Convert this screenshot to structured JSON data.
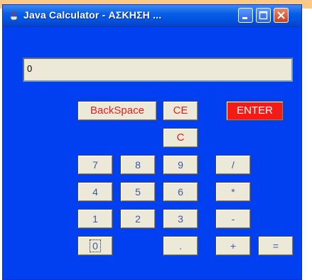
{
  "window": {
    "title": "Java Calculator - ΑΣΚΗΣΗ ...",
    "title_icon": "java-coffee-icon",
    "controls": {
      "minimize": "minimize-icon",
      "maximize": "maximize-icon",
      "close": "close-icon"
    }
  },
  "display": {
    "value": "0"
  },
  "buttons": {
    "backspace": "BackSpace",
    "ce": "CE",
    "enter": "ENTER",
    "c": "C",
    "seven": "7",
    "eight": "8",
    "nine": "9",
    "divide": "/",
    "four": "4",
    "five": "5",
    "six": "6",
    "multiply": "*",
    "one": "1",
    "two": "2",
    "three": "3",
    "minus": "-",
    "zero": "0",
    "dot": ".",
    "plus": "+",
    "equals": "="
  },
  "colors": {
    "window_bg": "#0040f0",
    "enter_bg": "#f21b16",
    "key_bg": "#ece9d8",
    "digit_text": "#3a5aa8",
    "function_text": "#e02020"
  }
}
